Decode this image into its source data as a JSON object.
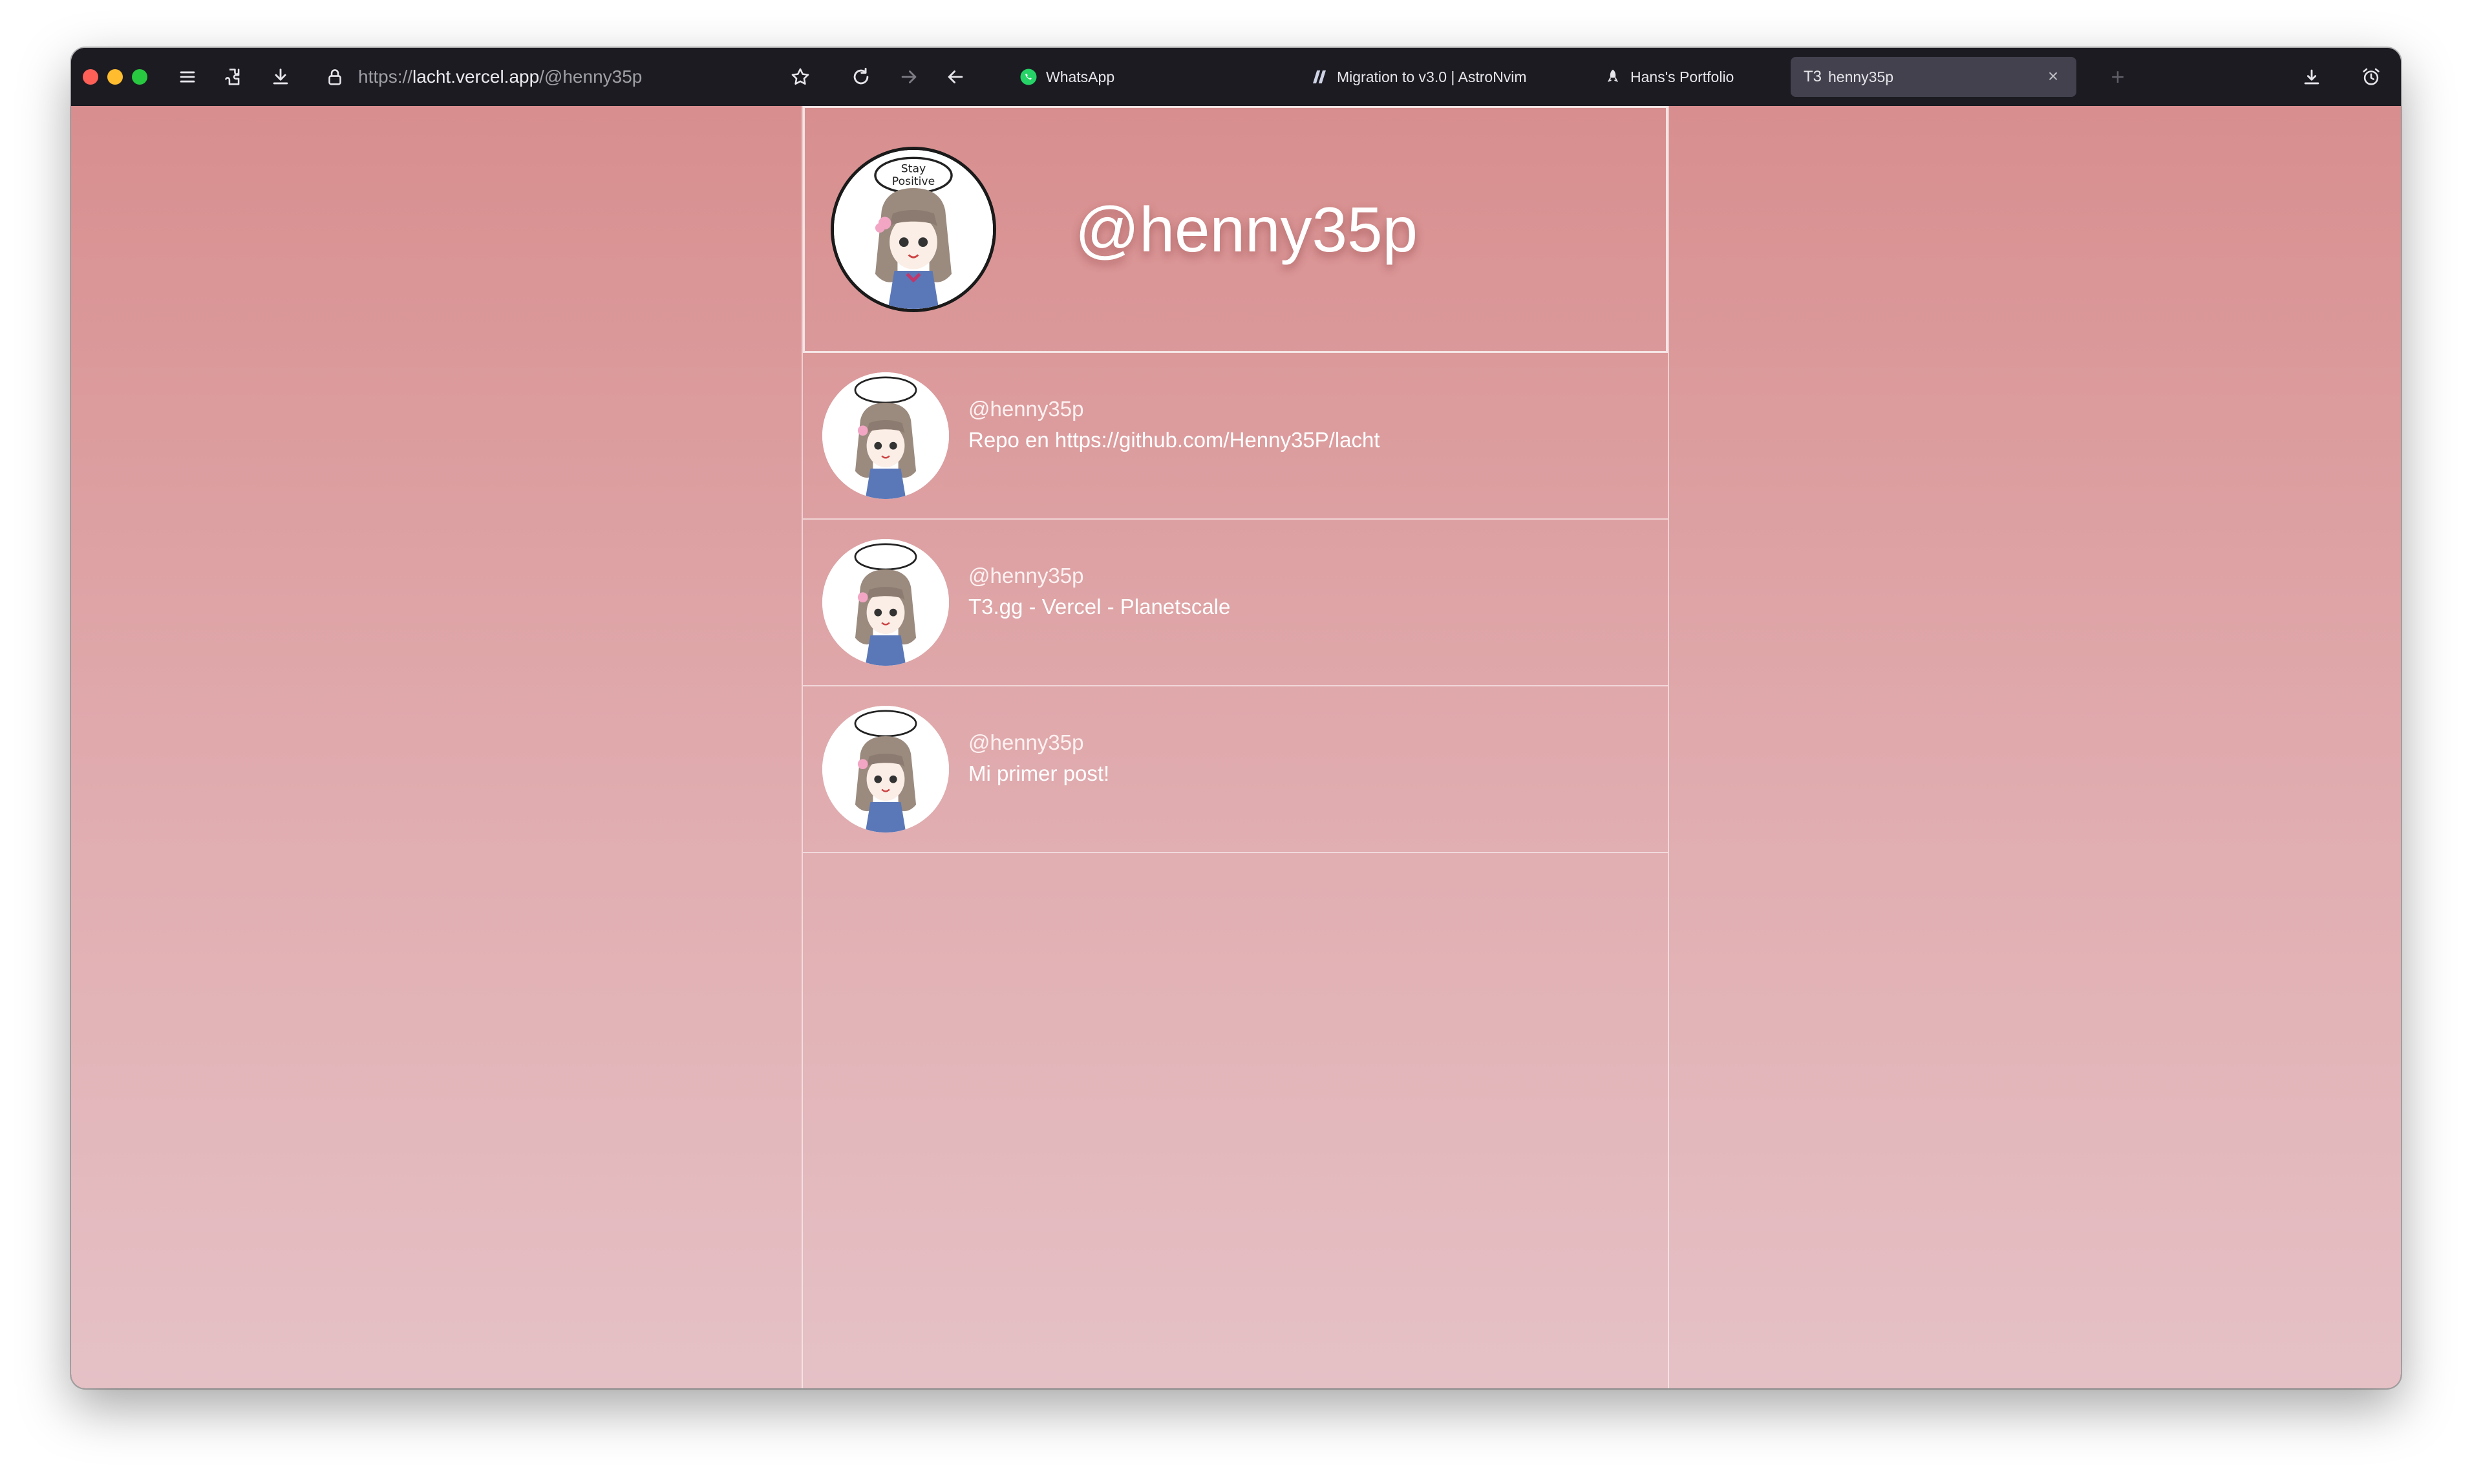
{
  "browser": {
    "url_scheme": "https://",
    "url_host": "lacht.vercel.app",
    "url_path": "/@henny35p",
    "tabs": [
      {
        "label": "WhatsApp",
        "icon": "whatsapp-icon",
        "active": false
      },
      {
        "label": "Migration to v3.0 | AstroNvim",
        "icon": "astronvim-icon",
        "active": false
      },
      {
        "label": "Hans's Portfolio",
        "icon": "rocket-icon",
        "active": false
      },
      {
        "label": "henny35p",
        "icon": "t3-icon",
        "active": true
      }
    ],
    "active_tab_prefix": "T3"
  },
  "profile": {
    "handle": "@henny35p",
    "avatar_caption_line1": "Stay",
    "avatar_caption_line2": "Positive"
  },
  "posts": [
    {
      "author": "@henny35p",
      "text": "Repo en https://github.com/Henny35P/lacht"
    },
    {
      "author": "@henny35p",
      "text": "T3.gg - Vercel - Planetscale"
    },
    {
      "author": "@henny35p",
      "text": "Mi primer post!"
    }
  ],
  "colors": {
    "gradient_top": "#d88e8e",
    "gradient_bottom": "#e5c1c6",
    "toolbar_bg": "#1c1b22",
    "active_tab_bg": "#42414d"
  }
}
